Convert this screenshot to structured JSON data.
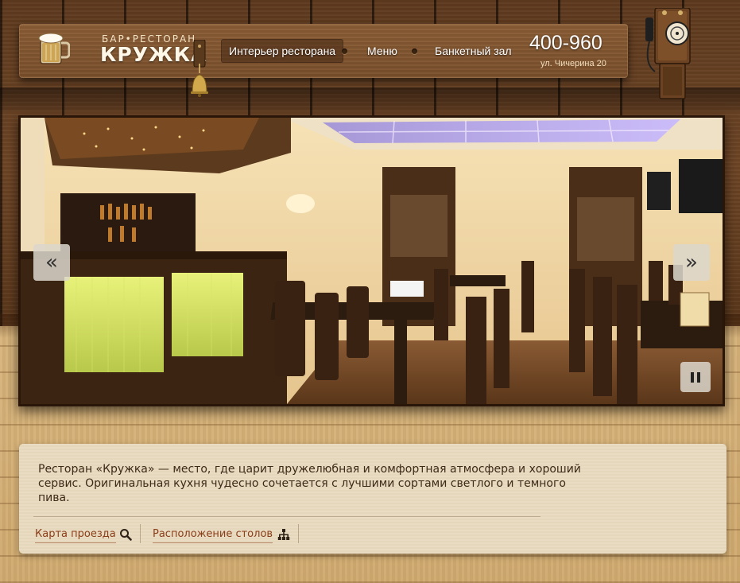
{
  "brand": {
    "tagline": "БАР•РЕСТОРАН",
    "name": "КРУЖКА"
  },
  "nav": {
    "items": [
      {
        "label": "Интерьер ресторана",
        "active": true
      },
      {
        "label": "Меню",
        "active": false
      },
      {
        "label": "Банкетный зал",
        "active": false
      }
    ]
  },
  "contact": {
    "phone": "400-960",
    "address": "ул. Чичерина 20"
  },
  "slider": {
    "prev_glyph": "«",
    "next_glyph": "»",
    "image_subject": "restaurant-interior-photo"
  },
  "description": {
    "text": "Ресторан «Кружка» — место, где царит дружелюбная и комфортная атмосфера и хороший сервис. Оригинальная кухня чудесно сочетается с лучшими сортами светлого и темного пива.",
    "links": [
      {
        "label": "Карта проезда",
        "icon": "search-icon"
      },
      {
        "label": "Расположение столов",
        "icon": "sitemap-icon"
      }
    ]
  },
  "colors": {
    "wood_dark": "#5e3a1e",
    "header_wood": "#8a5d35",
    "link": "#8b3e1a",
    "card_bg": "#e9dbc0"
  }
}
